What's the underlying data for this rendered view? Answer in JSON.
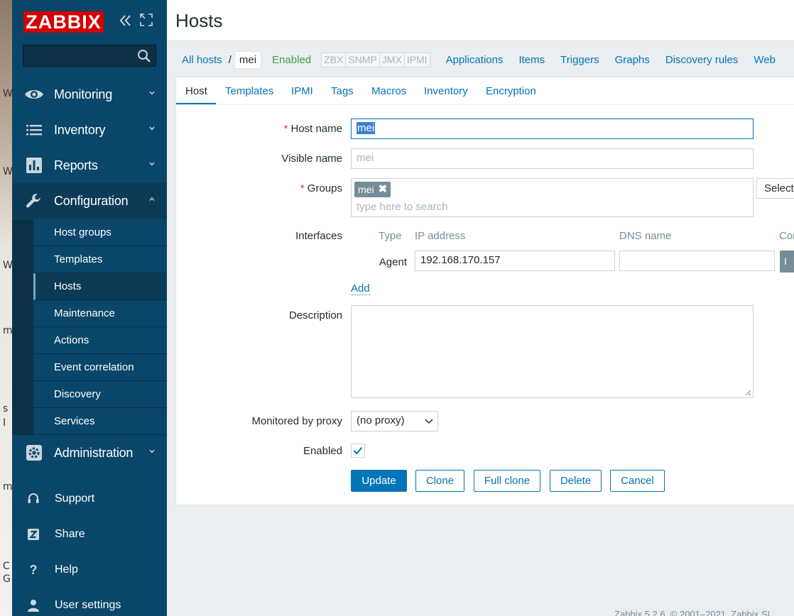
{
  "desktop": {
    "fragments": [
      "W",
      "W",
      "W",
      "m",
      "s",
      "I",
      "m",
      "C",
      "G"
    ]
  },
  "sidebar": {
    "logo": "ZABBIX",
    "search": {
      "placeholder": "",
      "value": ""
    },
    "menu": [
      {
        "label": "Monitoring",
        "icon": "eye-icon"
      },
      {
        "label": "Inventory",
        "icon": "list-icon"
      },
      {
        "label": "Reports",
        "icon": "bar-chart-icon"
      },
      {
        "label": "Configuration",
        "icon": "wrench-icon"
      }
    ],
    "configuration_items": [
      "Host groups",
      "Templates",
      "Hosts",
      "Maintenance",
      "Actions",
      "Event correlation",
      "Discovery",
      "Services"
    ],
    "administration": {
      "label": "Administration",
      "icon": "gear-icon"
    },
    "footer_items": [
      {
        "label": "Support",
        "icon": "headset-icon"
      },
      {
        "label": "Share",
        "icon": "share-z-icon"
      },
      {
        "label": "Help",
        "icon": "question-icon"
      },
      {
        "label": "User settings",
        "icon": "user-icon"
      }
    ]
  },
  "header": {
    "title": "Hosts"
  },
  "hostbar": {
    "all_hosts": "All hosts",
    "separator": "/",
    "current_host": "mei",
    "status": "Enabled",
    "availability": [
      "ZBX",
      "SNMP",
      "JMX",
      "IPMI"
    ],
    "links": [
      "Applications",
      "Items",
      "Triggers",
      "Graphs",
      "Discovery rules",
      "Web"
    ]
  },
  "tabs": [
    "Host",
    "Templates",
    "IPMI",
    "Tags",
    "Macros",
    "Inventory",
    "Encryption"
  ],
  "form": {
    "host_name": {
      "label": "Host name",
      "required": "*",
      "value": "mei"
    },
    "visible_name": {
      "label": "Visible name",
      "placeholder": "mei"
    },
    "groups": {
      "label": "Groups",
      "required": "*",
      "tags": [
        "mei"
      ],
      "remove_glyph": "✖",
      "search_placeholder": "type here to search",
      "select_button": "Select"
    },
    "interfaces": {
      "label": "Interfaces",
      "columns": [
        "Type",
        "IP address",
        "DNS name",
        "Con"
      ],
      "rows": [
        {
          "type": "Agent",
          "ip": "192.168.170.157",
          "dns": "",
          "connect": "I"
        }
      ],
      "add_link": "Add"
    },
    "description": {
      "label": "Description",
      "value": ""
    },
    "proxy": {
      "label": "Monitored by proxy",
      "value": "(no proxy)"
    },
    "enabled": {
      "label": "Enabled",
      "checked": true
    },
    "buttons": {
      "update": "Update",
      "clone": "Clone",
      "full_clone": "Full clone",
      "delete": "Delete",
      "cancel": "Cancel"
    }
  },
  "footer": {
    "text": "Zabbix 5.2.6. © 2001–2021, Zabbix SI"
  },
  "colors": {
    "sidebar": "#0a466a",
    "accent": "#0275b8",
    "logo": "#d40000",
    "enabled": "#429e47"
  }
}
